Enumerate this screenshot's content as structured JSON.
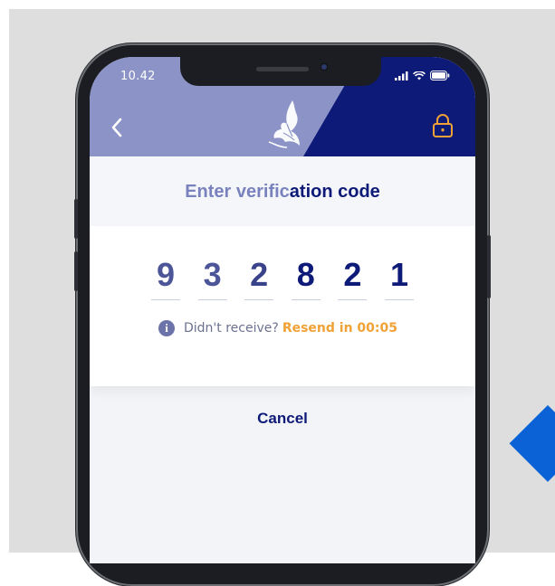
{
  "status_bar": {
    "time": "10.42"
  },
  "header": {
    "back_icon": "chevron-left-icon",
    "logo": "falcon-calligraphy-logo",
    "lock_icon": "lock-icon"
  },
  "title": {
    "light_part": "Enter verific",
    "bold_part": "ation code"
  },
  "code": {
    "digits": [
      "9",
      "3",
      "2",
      "8",
      "2",
      "1"
    ]
  },
  "resend": {
    "icon": "info-icon",
    "info_glyph": "i",
    "prompt": "Didn't receive?",
    "action": "Resend in 00:05"
  },
  "cancel_label": "Cancel",
  "colors": {
    "brand_navy": "#0d1a78",
    "header_light": "#8c93c6",
    "accent_orange": "#f0a236",
    "digit_light": "#4b5597",
    "digit_dark": "#0d1a78"
  }
}
